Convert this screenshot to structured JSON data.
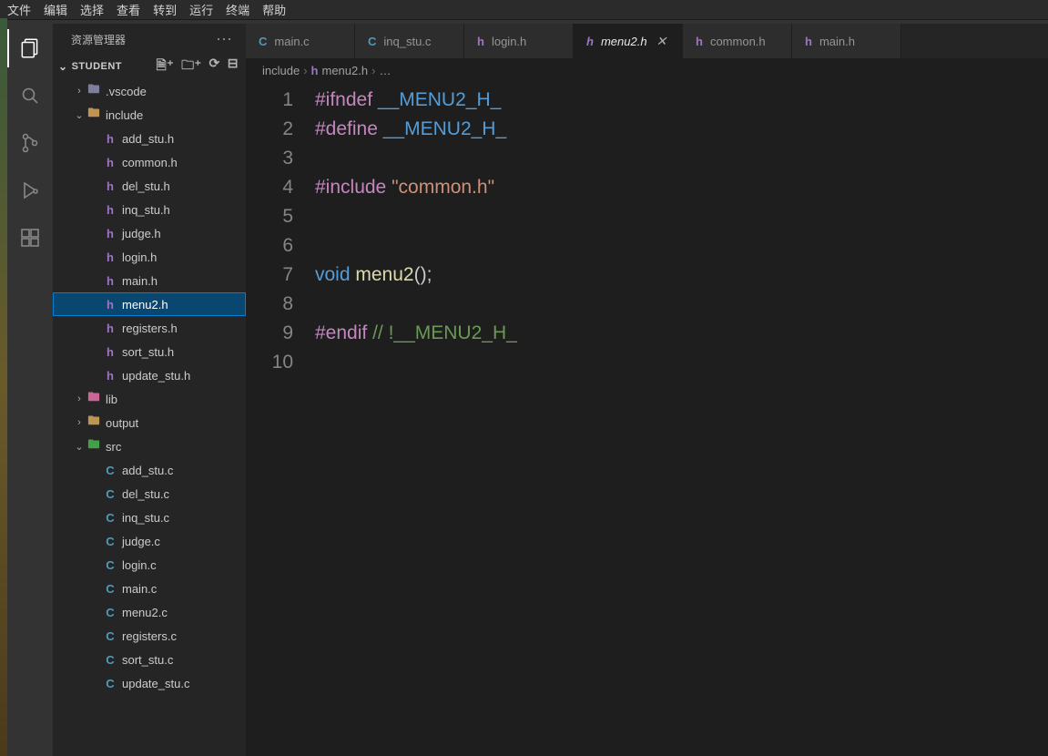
{
  "menu": {
    "items": [
      "文件",
      "编辑",
      "选择",
      "查看",
      "转到",
      "运行",
      "终端",
      "帮助"
    ]
  },
  "explorer": {
    "title": "资源管理器",
    "project": "STUDENT"
  },
  "tree": [
    {
      "d": 1,
      "t": "folder",
      "icon": "fldcfg",
      "chev": "›",
      "label": ".vscode"
    },
    {
      "d": 1,
      "t": "folder",
      "icon": "fld",
      "chev": "⌄",
      "label": "include"
    },
    {
      "d": 2,
      "t": "file",
      "icon": "h",
      "label": "add_stu.h"
    },
    {
      "d": 2,
      "t": "file",
      "icon": "h",
      "label": "common.h"
    },
    {
      "d": 2,
      "t": "file",
      "icon": "h",
      "label": "del_stu.h"
    },
    {
      "d": 2,
      "t": "file",
      "icon": "h",
      "label": "inq_stu.h"
    },
    {
      "d": 2,
      "t": "file",
      "icon": "h",
      "label": "judge.h"
    },
    {
      "d": 2,
      "t": "file",
      "icon": "h",
      "label": "login.h"
    },
    {
      "d": 2,
      "t": "file",
      "icon": "h",
      "label": "main.h"
    },
    {
      "d": 2,
      "t": "file",
      "icon": "h",
      "label": "menu2.h",
      "sel": true
    },
    {
      "d": 2,
      "t": "file",
      "icon": "h",
      "label": "registers.h"
    },
    {
      "d": 2,
      "t": "file",
      "icon": "h",
      "label": "sort_stu.h"
    },
    {
      "d": 2,
      "t": "file",
      "icon": "h",
      "label": "update_stu.h"
    },
    {
      "d": 1,
      "t": "folder",
      "icon": "fldlib",
      "chev": "›",
      "label": "lib"
    },
    {
      "d": 1,
      "t": "folder",
      "icon": "fld",
      "chev": "›",
      "label": "output"
    },
    {
      "d": 1,
      "t": "folder",
      "icon": "fldsrc",
      "chev": "⌄",
      "label": "src"
    },
    {
      "d": 2,
      "t": "file",
      "icon": "c",
      "label": "add_stu.c"
    },
    {
      "d": 2,
      "t": "file",
      "icon": "c",
      "label": "del_stu.c"
    },
    {
      "d": 2,
      "t": "file",
      "icon": "c",
      "label": "inq_stu.c"
    },
    {
      "d": 2,
      "t": "file",
      "icon": "c",
      "label": "judge.c"
    },
    {
      "d": 2,
      "t": "file",
      "icon": "c",
      "label": "login.c"
    },
    {
      "d": 2,
      "t": "file",
      "icon": "c",
      "label": "main.c"
    },
    {
      "d": 2,
      "t": "file",
      "icon": "c",
      "label": "menu2.c"
    },
    {
      "d": 2,
      "t": "file",
      "icon": "c",
      "label": "registers.c"
    },
    {
      "d": 2,
      "t": "file",
      "icon": "c",
      "label": "sort_stu.c"
    },
    {
      "d": 2,
      "t": "file",
      "icon": "c",
      "label": "update_stu.c"
    }
  ],
  "tabs": [
    {
      "icon": "c",
      "label": "main.c"
    },
    {
      "icon": "c",
      "label": "inq_stu.c"
    },
    {
      "icon": "h",
      "label": "login.h"
    },
    {
      "icon": "h",
      "label": "menu2.h",
      "active": true,
      "mod": true,
      "close": true
    },
    {
      "icon": "h",
      "label": "common.h"
    },
    {
      "icon": "h",
      "label": "main.h"
    }
  ],
  "crumbs": {
    "folder": "include",
    "file": "menu2.h",
    "tail": "…"
  },
  "code": {
    "lines": [
      "1",
      "2",
      "3",
      "4",
      "5",
      "6",
      "7",
      "8",
      "9",
      "10"
    ],
    "src": [
      [
        [
          "kw",
          "#ifndef"
        ],
        [
          "",
          " "
        ],
        [
          "mac",
          "__MENU2_H_"
        ]
      ],
      [
        [
          "kw",
          "#define"
        ],
        [
          "",
          " "
        ],
        [
          "mac",
          "__MENU2_H_"
        ]
      ],
      [],
      [
        [
          "kw",
          "#include"
        ],
        [
          "",
          " "
        ],
        [
          "str",
          "\"common.h\""
        ]
      ],
      [],
      [],
      [
        [
          "typ",
          "void"
        ],
        [
          "",
          " "
        ],
        [
          "fn",
          "menu2"
        ],
        [
          "",
          "();"
        ]
      ],
      [],
      [
        [
          "kw",
          "#endif"
        ],
        [
          "",
          " "
        ],
        [
          "cmt",
          "// !__MENU2_H_"
        ]
      ],
      []
    ]
  }
}
